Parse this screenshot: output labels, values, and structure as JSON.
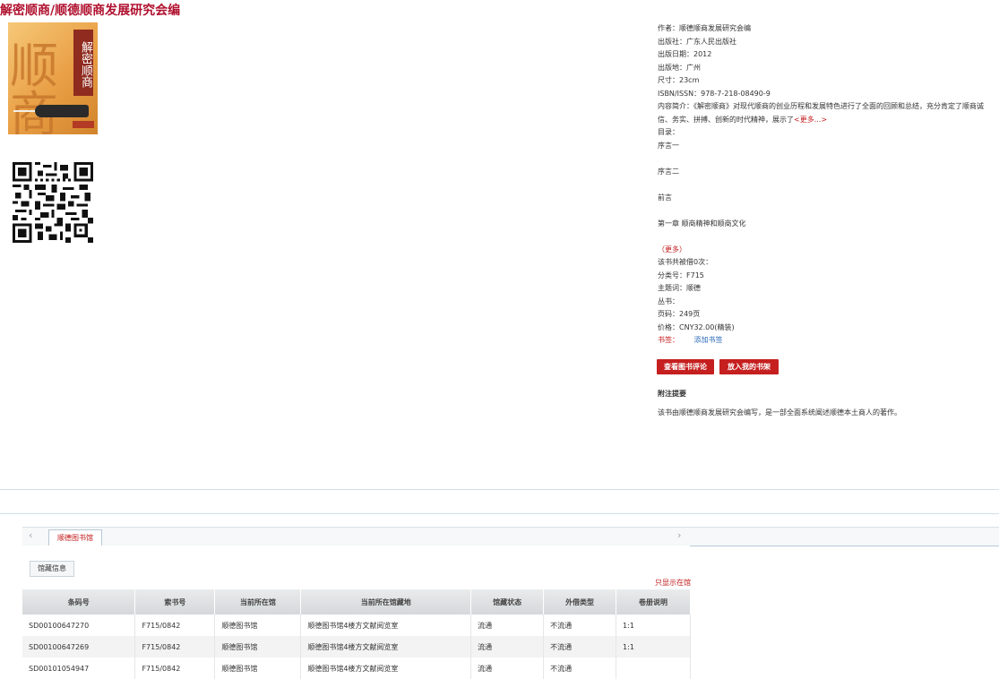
{
  "page": {
    "title": "解密顺商/顺德顺商发展研究会编"
  },
  "cover": {
    "big_char": "顺商",
    "band_text": "解密顺商"
  },
  "info": {
    "author": "作者：顺德顺商发展研究会编",
    "publisher": "出版社：广东人民出版社",
    "pub_date": "出版日期：2012",
    "pub_place": "出版地：广州",
    "size": "尺寸：23cm",
    "isbn": "ISBN/ISSN：978-7-218-08490-9",
    "summary": "内容简介：《解密顺商》对现代顺商的创业历程和发展特色进行了全面的回顾和总结，充分肯定了顺商诚信、务实、拼搏、创新的时代精神，展示了",
    "summary_more": "<更多...>",
    "toc_label": "目录：",
    "toc": [
      "序言一",
      "序言二",
      "前言",
      "第一章 顺商精神和顺商文化"
    ],
    "toc_more": "（更多）",
    "borrow_count": "该书共被借0次：",
    "class_no": "分类号：F715",
    "subject": "主题词：顺德",
    "series": "丛书：",
    "pages": "页码：249页",
    "price": "价格：CNY32.00(精装)",
    "bookmark_label": "书签：",
    "bookmark_add": "添加书签"
  },
  "buttons": {
    "review": "查看图书评论",
    "shelf": "放入我的书架"
  },
  "notes": {
    "heading": "附注提要",
    "body": "该书由顺德顺商发展研究会编写，是一部全面系统阐述顺德本土商人的著作。"
  },
  "tabs": {
    "left_arrow": "‹",
    "right_arrow": "›",
    "library": "顺德图书馆",
    "holding_info": "馆藏信息",
    "only_in": "只显示在馆"
  },
  "table": {
    "headers": [
      "条码号",
      "索书号",
      "当前所在馆",
      "当前所在馆藏地",
      "馆藏状态",
      "外借类型",
      "卷册说明"
    ],
    "rows": [
      [
        "SD00100647270",
        "F715/0842",
        "顺德图书馆",
        "顺德图书馆4楼方文献阅览室",
        "流通",
        "不流通",
        "1:1"
      ],
      [
        "SD00100647269",
        "F715/0842",
        "顺德图书馆",
        "顺德图书馆4楼方文献阅览室",
        "流通",
        "不流通",
        "1:1"
      ],
      [
        "SD00101054947",
        "F715/0842",
        "顺德图书馆",
        "顺德图书馆4楼方文献阅览室",
        "流通",
        "不流通",
        ""
      ]
    ]
  },
  "colors": {
    "accent_red": "#c21b1b",
    "title_red": "#b0112f",
    "link_blue": "#2a6ab8"
  }
}
